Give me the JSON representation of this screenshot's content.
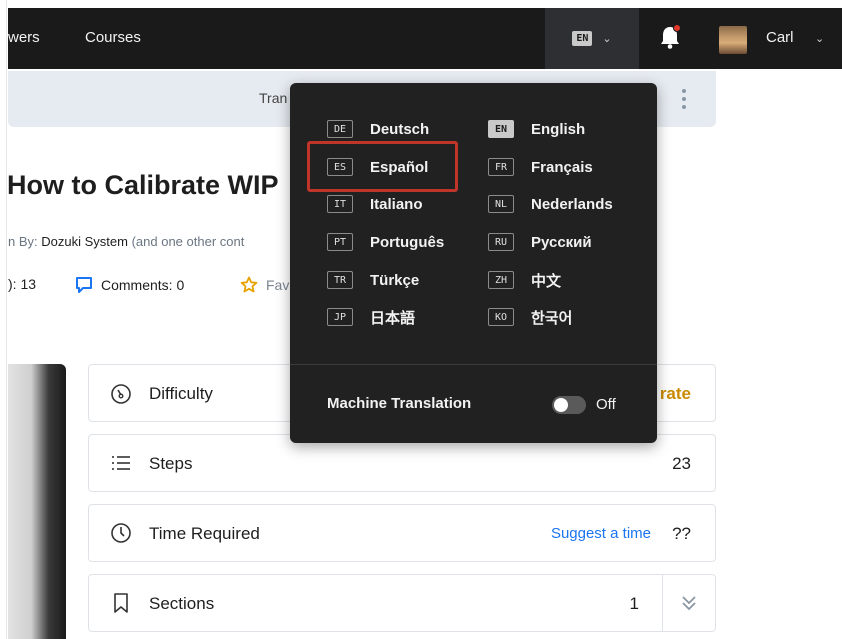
{
  "nav": {
    "links": [
      "wers",
      "Courses"
    ],
    "language_code": "EN",
    "user_name": "Carl"
  },
  "translation_bar": {
    "text": "Tran"
  },
  "guide": {
    "title": "How to Calibrate WIP",
    "author_prefix": "n By:",
    "author_name": "Dozuki System",
    "author_suffix": "(and one other cont",
    "views": "): 13",
    "comments": "Comments: 0",
    "favorites": "Fav"
  },
  "info_cards": {
    "difficulty_label": "Difficulty",
    "difficulty_value": "rate",
    "steps_label": "Steps",
    "steps_value": "23",
    "time_label": "Time Required",
    "time_suggest": "Suggest a time",
    "time_value": "??",
    "sections_label": "Sections",
    "sections_value": "1"
  },
  "language_menu": {
    "languages": [
      {
        "code": "DE",
        "name": "Deutsch"
      },
      {
        "code": "EN",
        "name": "English"
      },
      {
        "code": "ES",
        "name": "Español"
      },
      {
        "code": "FR",
        "name": "Français"
      },
      {
        "code": "IT",
        "name": "Italiano"
      },
      {
        "code": "NL",
        "name": "Nederlands"
      },
      {
        "code": "PT",
        "name": "Português"
      },
      {
        "code": "RU",
        "name": "Русский"
      },
      {
        "code": "TR",
        "name": "Türkçe"
      },
      {
        "code": "ZH",
        "name": "中文"
      },
      {
        "code": "JP",
        "name": "日本語"
      },
      {
        "code": "KO",
        "name": "한국어"
      }
    ],
    "active_code": "EN",
    "highlighted_code": "ES",
    "machine_translation_label": "Machine Translation",
    "machine_translation_state": "Off"
  },
  "colors": {
    "nav_bg": "#1a1a1a",
    "dropdown_bg": "#212121",
    "highlight": "#c0352a",
    "link": "#1975f2",
    "difficulty": "#c98a00"
  }
}
